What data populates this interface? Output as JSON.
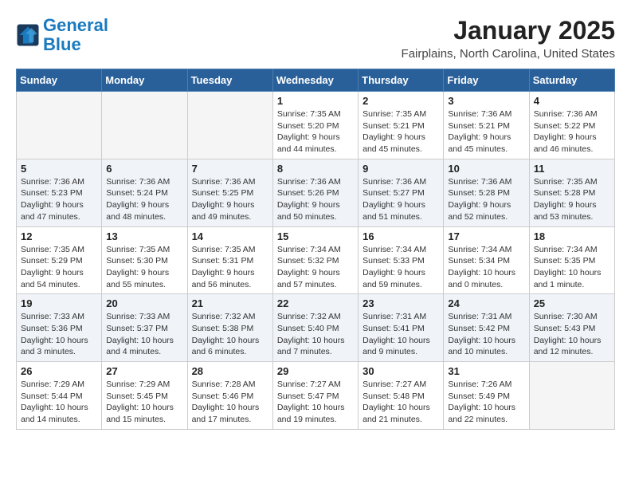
{
  "header": {
    "logo_line1": "General",
    "logo_line2": "Blue",
    "month_year": "January 2025",
    "location": "Fairplains, North Carolina, United States"
  },
  "days_of_week": [
    "Sunday",
    "Monday",
    "Tuesday",
    "Wednesday",
    "Thursday",
    "Friday",
    "Saturday"
  ],
  "weeks": [
    [
      {
        "day": "",
        "empty": true
      },
      {
        "day": "",
        "empty": true
      },
      {
        "day": "",
        "empty": true
      },
      {
        "day": "1",
        "sunrise": "7:35 AM",
        "sunset": "5:20 PM",
        "daylight": "9 hours and 44 minutes."
      },
      {
        "day": "2",
        "sunrise": "7:35 AM",
        "sunset": "5:21 PM",
        "daylight": "9 hours and 45 minutes."
      },
      {
        "day": "3",
        "sunrise": "7:36 AM",
        "sunset": "5:21 PM",
        "daylight": "9 hours and 45 minutes."
      },
      {
        "day": "4",
        "sunrise": "7:36 AM",
        "sunset": "5:22 PM",
        "daylight": "9 hours and 46 minutes."
      }
    ],
    [
      {
        "day": "5",
        "sunrise": "7:36 AM",
        "sunset": "5:23 PM",
        "daylight": "9 hours and 47 minutes."
      },
      {
        "day": "6",
        "sunrise": "7:36 AM",
        "sunset": "5:24 PM",
        "daylight": "9 hours and 48 minutes."
      },
      {
        "day": "7",
        "sunrise": "7:36 AM",
        "sunset": "5:25 PM",
        "daylight": "9 hours and 49 minutes."
      },
      {
        "day": "8",
        "sunrise": "7:36 AM",
        "sunset": "5:26 PM",
        "daylight": "9 hours and 50 minutes."
      },
      {
        "day": "9",
        "sunrise": "7:36 AM",
        "sunset": "5:27 PM",
        "daylight": "9 hours and 51 minutes."
      },
      {
        "day": "10",
        "sunrise": "7:36 AM",
        "sunset": "5:28 PM",
        "daylight": "9 hours and 52 minutes."
      },
      {
        "day": "11",
        "sunrise": "7:35 AM",
        "sunset": "5:28 PM",
        "daylight": "9 hours and 53 minutes."
      }
    ],
    [
      {
        "day": "12",
        "sunrise": "7:35 AM",
        "sunset": "5:29 PM",
        "daylight": "9 hours and 54 minutes."
      },
      {
        "day": "13",
        "sunrise": "7:35 AM",
        "sunset": "5:30 PM",
        "daylight": "9 hours and 55 minutes."
      },
      {
        "day": "14",
        "sunrise": "7:35 AM",
        "sunset": "5:31 PM",
        "daylight": "9 hours and 56 minutes."
      },
      {
        "day": "15",
        "sunrise": "7:34 AM",
        "sunset": "5:32 PM",
        "daylight": "9 hours and 57 minutes."
      },
      {
        "day": "16",
        "sunrise": "7:34 AM",
        "sunset": "5:33 PM",
        "daylight": "9 hours and 59 minutes."
      },
      {
        "day": "17",
        "sunrise": "7:34 AM",
        "sunset": "5:34 PM",
        "daylight": "10 hours and 0 minutes."
      },
      {
        "day": "18",
        "sunrise": "7:34 AM",
        "sunset": "5:35 PM",
        "daylight": "10 hours and 1 minute."
      }
    ],
    [
      {
        "day": "19",
        "sunrise": "7:33 AM",
        "sunset": "5:36 PM",
        "daylight": "10 hours and 3 minutes."
      },
      {
        "day": "20",
        "sunrise": "7:33 AM",
        "sunset": "5:37 PM",
        "daylight": "10 hours and 4 minutes."
      },
      {
        "day": "21",
        "sunrise": "7:32 AM",
        "sunset": "5:38 PM",
        "daylight": "10 hours and 6 minutes."
      },
      {
        "day": "22",
        "sunrise": "7:32 AM",
        "sunset": "5:40 PM",
        "daylight": "10 hours and 7 minutes."
      },
      {
        "day": "23",
        "sunrise": "7:31 AM",
        "sunset": "5:41 PM",
        "daylight": "10 hours and 9 minutes."
      },
      {
        "day": "24",
        "sunrise": "7:31 AM",
        "sunset": "5:42 PM",
        "daylight": "10 hours and 10 minutes."
      },
      {
        "day": "25",
        "sunrise": "7:30 AM",
        "sunset": "5:43 PM",
        "daylight": "10 hours and 12 minutes."
      }
    ],
    [
      {
        "day": "26",
        "sunrise": "7:29 AM",
        "sunset": "5:44 PM",
        "daylight": "10 hours and 14 minutes."
      },
      {
        "day": "27",
        "sunrise": "7:29 AM",
        "sunset": "5:45 PM",
        "daylight": "10 hours and 15 minutes."
      },
      {
        "day": "28",
        "sunrise": "7:28 AM",
        "sunset": "5:46 PM",
        "daylight": "10 hours and 17 minutes."
      },
      {
        "day": "29",
        "sunrise": "7:27 AM",
        "sunset": "5:47 PM",
        "daylight": "10 hours and 19 minutes."
      },
      {
        "day": "30",
        "sunrise": "7:27 AM",
        "sunset": "5:48 PM",
        "daylight": "10 hours and 21 minutes."
      },
      {
        "day": "31",
        "sunrise": "7:26 AM",
        "sunset": "5:49 PM",
        "daylight": "10 hours and 22 minutes."
      },
      {
        "day": "",
        "empty": true
      }
    ]
  ]
}
